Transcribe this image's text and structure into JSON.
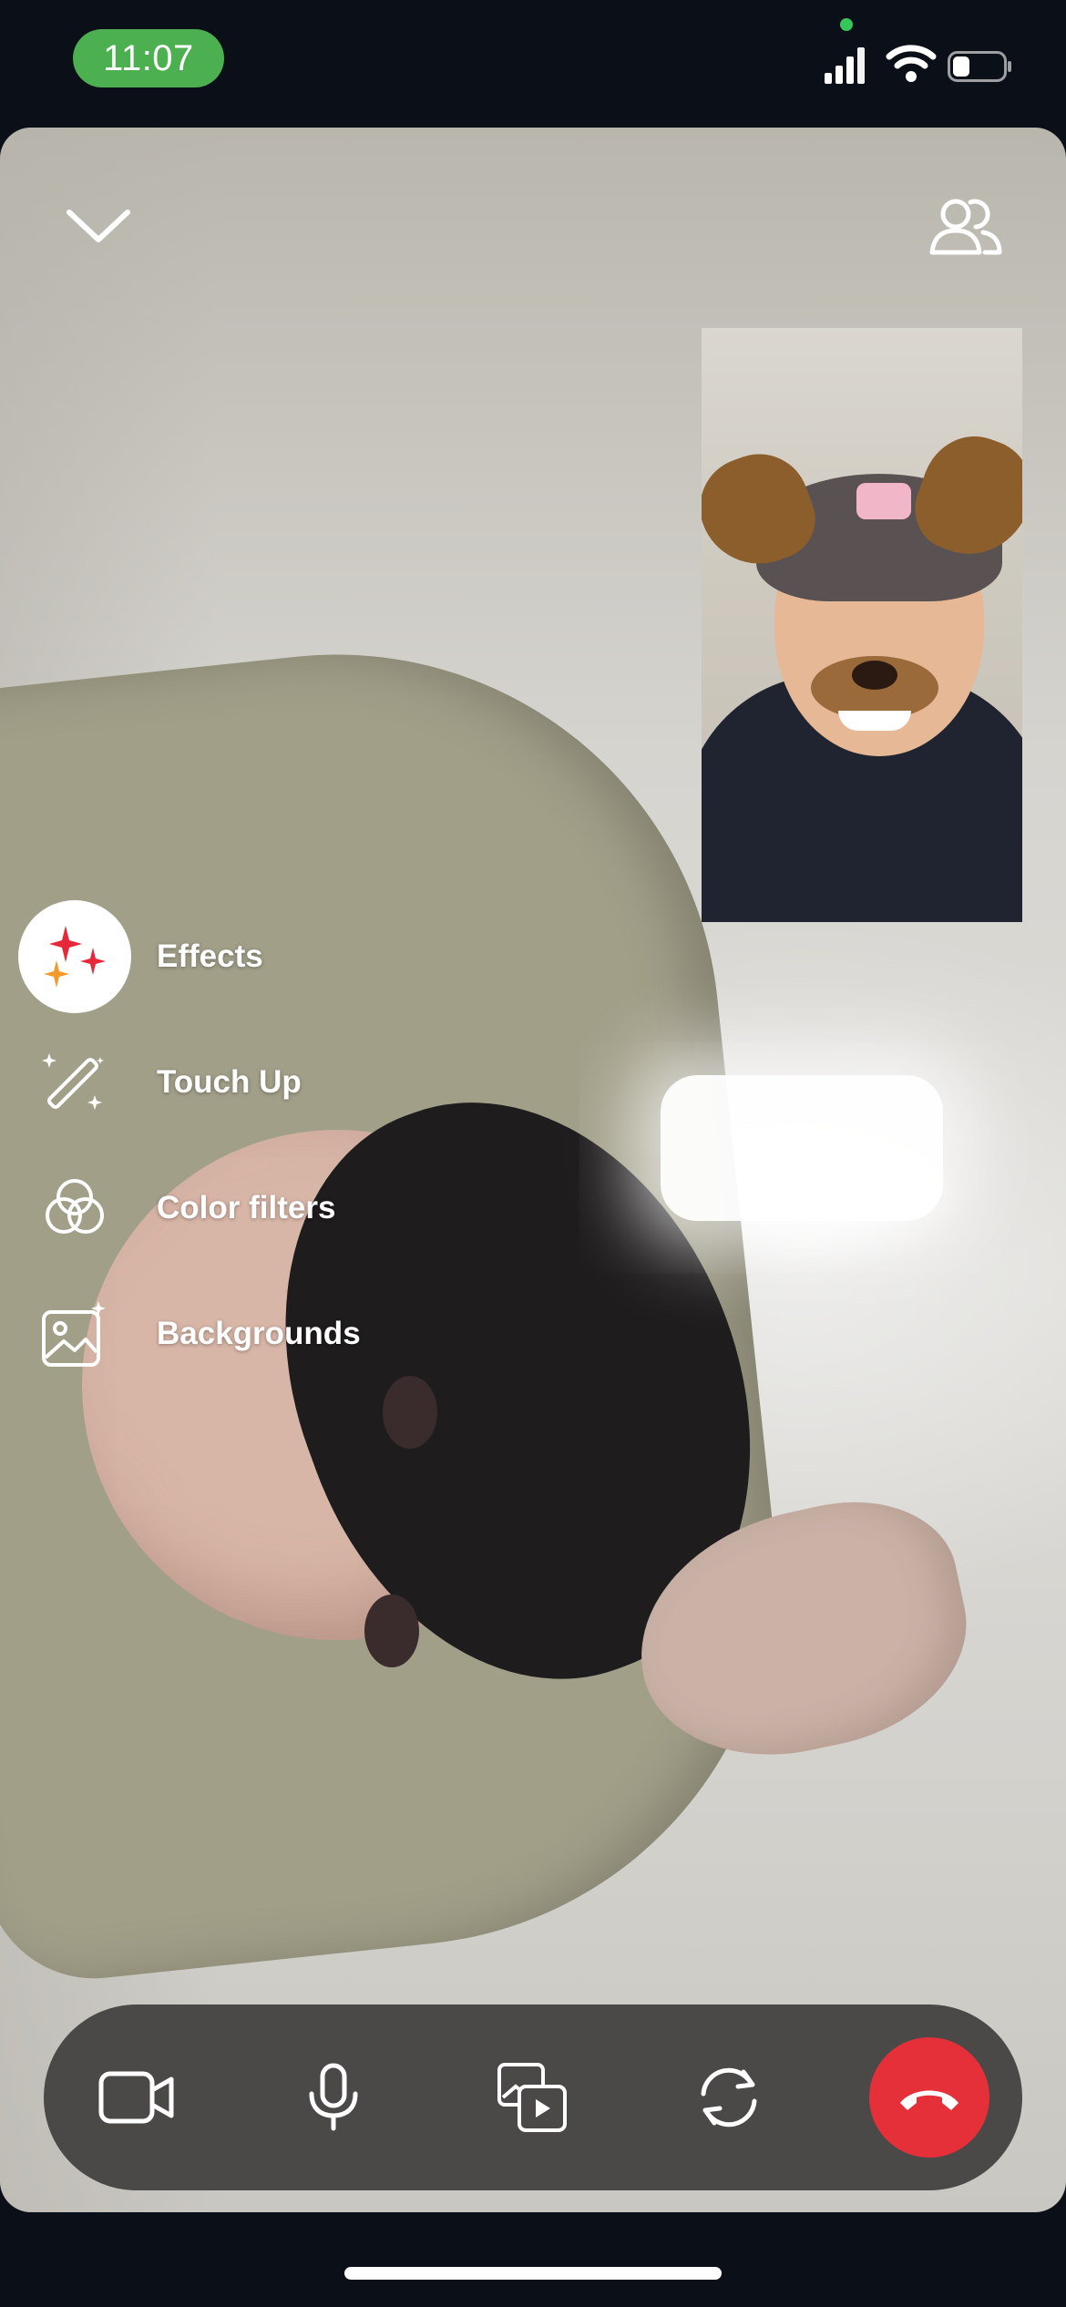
{
  "status_bar": {
    "time": "11:07",
    "icons": [
      "cellular-signal-icon",
      "wifi-icon",
      "battery-icon"
    ],
    "accent_color": "#4caf50"
  },
  "top_controls": {
    "collapse_icon": "chevron-down-icon",
    "participants_icon": "people-icon"
  },
  "self_view": {
    "filter": "dog-ears"
  },
  "effects_menu": {
    "items": [
      {
        "label": "Effects",
        "icon": "sparkles-icon",
        "selected": true
      },
      {
        "label": "Touch Up",
        "icon": "magic-wand-icon",
        "selected": false
      },
      {
        "label": "Color filters",
        "icon": "color-circles-icon",
        "selected": false
      },
      {
        "label": "Backgrounds",
        "icon": "image-sparkle-icon",
        "selected": false
      }
    ]
  },
  "call_controls": {
    "buttons": [
      "video-camera-icon",
      "microphone-icon",
      "share-media-icon",
      "flip-camera-icon",
      "end-call-icon"
    ],
    "end_call_color": "#e5303a"
  }
}
